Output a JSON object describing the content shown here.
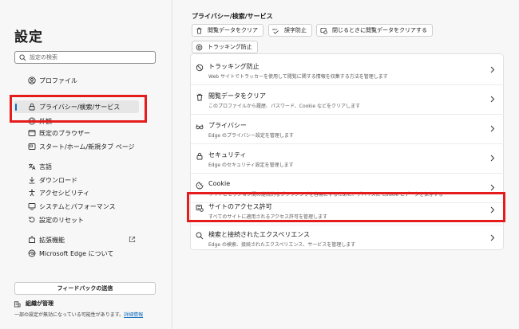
{
  "sidebar": {
    "title": "設定",
    "search_placeholder": "設定の検索",
    "items": [
      {
        "label": "プロファイル",
        "icon": "profile-icon"
      },
      {
        "label": "プライバシー/検索/サービス",
        "icon": "privacy-lock-icon"
      },
      {
        "label": "外観",
        "icon": "appearance-icon"
      },
      {
        "label": "既定のブラウザー",
        "icon": "browser-icon"
      },
      {
        "label": "スタート/ホーム/新規タブ ページ",
        "icon": "home-icon"
      },
      {
        "label": "言語",
        "icon": "language-icon"
      },
      {
        "label": "ダウンロード",
        "icon": "download-icon"
      },
      {
        "label": "アクセシビリティ",
        "icon": "accessibility-icon"
      },
      {
        "label": "システムとパフォーマンス",
        "icon": "system-icon"
      },
      {
        "label": "設定のリセット",
        "icon": "reset-icon"
      },
      {
        "label": "拡張機能",
        "icon": "extensions-icon"
      },
      {
        "label": "Microsoft Edge について",
        "icon": "edge-icon"
      }
    ],
    "feedback_label": "フィードバックの送信",
    "org_label": "組織が管理",
    "org_note": "一部の設定が無効になっている可能性があります。",
    "org_link": "詳細情報"
  },
  "main": {
    "section_title": "プライバシー/検索/サービス",
    "chips": [
      {
        "label": "閲覧データをクリア",
        "icon": "trash-icon"
      },
      {
        "label": "誤字防止",
        "icon": "spellcheck-icon"
      },
      {
        "label": "閉じるときに閲覧データをクリアする",
        "icon": "clear-on-close-icon"
      },
      {
        "label": "トラッキング防止",
        "icon": "tracking-icon"
      }
    ],
    "rows": [
      {
        "title": "トラッキング防止",
        "desc": "Web サイトでトラッカーを使用して閲覧に関する情報を収集する方法を管理します",
        "icon": "tracking-prevention-icon"
      },
      {
        "title": "閲覧データをクリア",
        "desc": "このプロファイルから履歴、パスワード、Cookie などをクリアします",
        "icon": "trash-icon"
      },
      {
        "title": "プライバシー",
        "desc": "Edge のプライバシー設定を管理します",
        "icon": "privacy-glasses-icon"
      },
      {
        "title": "セキュリティ",
        "desc": "Edge のセキュリティ設定を管理します",
        "icon": "security-lock-icon"
      },
      {
        "title": "Cookie",
        "desc": "サイトとセッション間の継続的なブラウジングを容易にするために、デバイスに Cookie とデータを保存する",
        "icon": "cookie-icon"
      },
      {
        "title": "サイトのアクセス許可",
        "desc": "すべてのサイトに適用されるアクセス許可を管理します",
        "icon": "site-permissions-icon"
      },
      {
        "title": "検索と接続されたエクスペリエンス",
        "desc": "Edge の検索、接続されたエクスペリエンス、サービスを管理します",
        "icon": "search-icon"
      }
    ]
  },
  "colors": {
    "accent": "#0f6cbd",
    "highlight": "#e51c1c"
  }
}
